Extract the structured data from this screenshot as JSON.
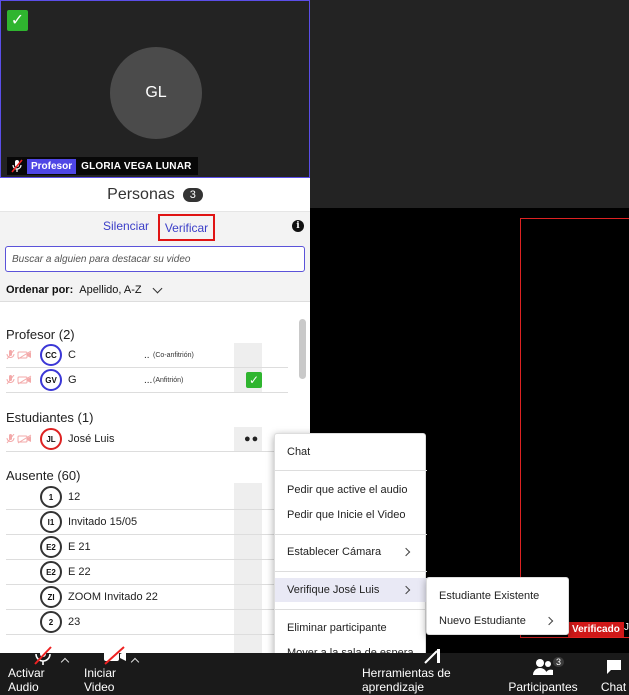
{
  "tile": {
    "avatar_initials": "GL",
    "role_badge": "Profesor",
    "name": "GLORIA VEGA LUNAR"
  },
  "panel": {
    "title": "Personas",
    "count": "3",
    "silence_label": "Silenciar",
    "verify_label": "Verificar",
    "search_placeholder": "Buscar a alguien para destacar su video",
    "sort_label": "Ordenar por:",
    "sort_value": "Apellido, A-Z"
  },
  "sections": {
    "profesor": "Profesor (2)",
    "estudiantes": "Estudiantes  (1)",
    "ausente": "Ausente  (60)"
  },
  "profesores": [
    {
      "initials": "CC",
      "name": "C",
      "dots": "..",
      "tag": "(Co-anfitrión)"
    },
    {
      "initials": "GV",
      "name": "G",
      "dots": "...",
      "tag": "(Anfitrión)"
    }
  ],
  "estudiantes": [
    {
      "initials": "JL",
      "name": "José Luis"
    }
  ],
  "ausentes": [
    {
      "initials": "1",
      "name": "12"
    },
    {
      "initials": "I1",
      "name": "Invitado 15/05"
    },
    {
      "initials": "E2",
      "name": "E 21"
    },
    {
      "initials": "E2",
      "name": "E 22"
    },
    {
      "initials": "ZI",
      "name": "ZOOM Invitado 22"
    },
    {
      "initials": "2",
      "name": "23"
    }
  ],
  "context_menu": {
    "chat": "Chat",
    "ask_audio": "Pedir que active el audio",
    "ask_video": "Pedir que Inicie el Video",
    "set_camera": "Establecer Cámara",
    "verify": "Verifique José Luis",
    "remove": "Eliminar participante",
    "waiting_room": "Mover a la sala de espera"
  },
  "submenu": {
    "existing": "Estudiante Existente",
    "new": "Nuevo Estudiante"
  },
  "stage": {
    "verified_tag": "Verificado",
    "verified_tail": "J"
  },
  "toolbar": {
    "audio": "Activar Audio",
    "video": "Iniciar Video",
    "tools": "Herramientas de aprendizaje",
    "participants": "Participantes",
    "participants_count": "3",
    "chat": "Chat"
  },
  "colors": {
    "accent": "#4f46e5",
    "verify_border": "#e01414",
    "check_green": "#2fb52f",
    "verified_red": "#d01818"
  }
}
